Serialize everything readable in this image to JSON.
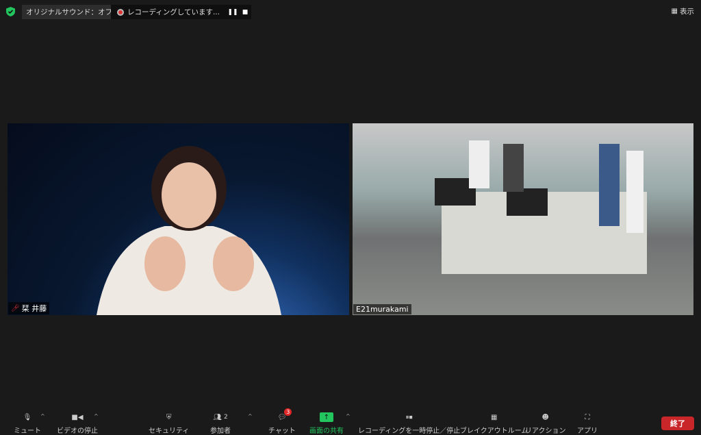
{
  "top": {
    "audio_label": "オリジナルサウンド：オフ",
    "recording_label": "レコーディングしています...",
    "view_label": "表示"
  },
  "tiles": [
    {
      "name": "栞 井藤"
    },
    {
      "name": "E21murakami"
    }
  ],
  "toolbar": {
    "mute": "ミュート",
    "video": "ビデオの停止",
    "security": "セキュリティ",
    "participants": "参加者",
    "participants_count": "2",
    "chat": "チャット",
    "chat_badge": "3",
    "share": "画面の共有",
    "recording": "レコーディングを一時停止／停止",
    "breakout": "ブレイクアウトルーム",
    "reaction": "リアクション",
    "apps": "アプリ",
    "end": "終了"
  },
  "colors": {
    "share": "#22c55e",
    "end": "#c9262a",
    "badge": "#e02828"
  }
}
